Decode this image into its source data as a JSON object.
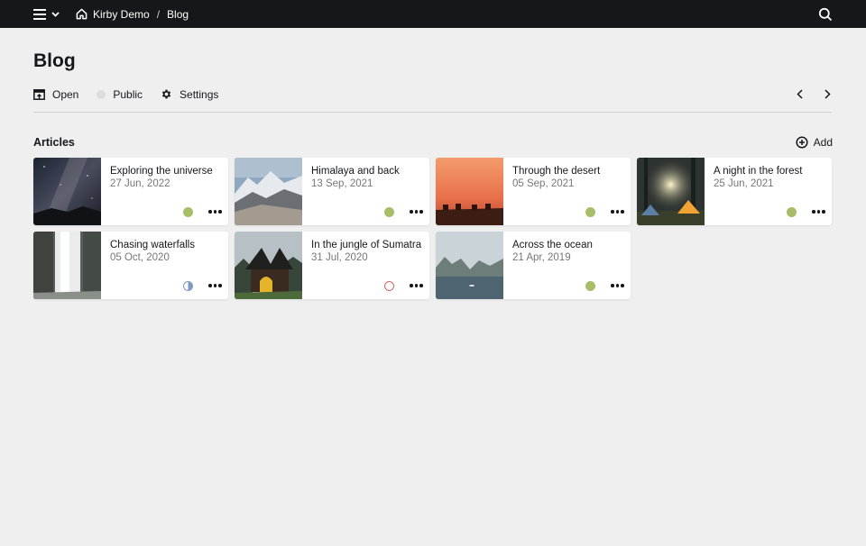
{
  "topbar": {
    "site_name": "Kirby Demo",
    "current_page": "Blog",
    "icons": {
      "menu": "hamburger-icon",
      "dropdown": "chevron-down-icon",
      "home": "home-icon",
      "search": "search-icon"
    }
  },
  "header": {
    "title": "Blog",
    "toolbar": {
      "open_label": "Open",
      "status_label": "Public",
      "settings_label": "Settings"
    }
  },
  "section": {
    "title": "Articles",
    "add_label": "Add"
  },
  "articles": [
    {
      "title": "Exploring the universe",
      "date": "27 Jun, 2022",
      "status": "listed",
      "image": "night-sky"
    },
    {
      "title": "Himalaya and back",
      "date": "13 Sep, 2021",
      "status": "listed",
      "image": "mountains"
    },
    {
      "title": "Through the desert",
      "date": "05 Sep, 2021",
      "status": "listed",
      "image": "desert"
    },
    {
      "title": "A night in the forest",
      "date": "25 Jun, 2021",
      "status": "listed",
      "image": "forest-camp"
    },
    {
      "title": "Chasing waterfalls",
      "date": "05 Oct, 2020",
      "status": "unlisted",
      "image": "waterfall"
    },
    {
      "title": "In the jungle of Sumatra",
      "date": "31 Jul, 2020",
      "status": "draft",
      "image": "jungle-house"
    },
    {
      "title": "Across the ocean",
      "date": "21 Apr, 2019",
      "status": "listed",
      "image": "ocean-bay"
    }
  ],
  "colors": {
    "topbar": "#16171a",
    "background": "#efefef",
    "listed": "#a7bd68",
    "unlisted": "#7e9abf",
    "draft": "#d16464"
  }
}
